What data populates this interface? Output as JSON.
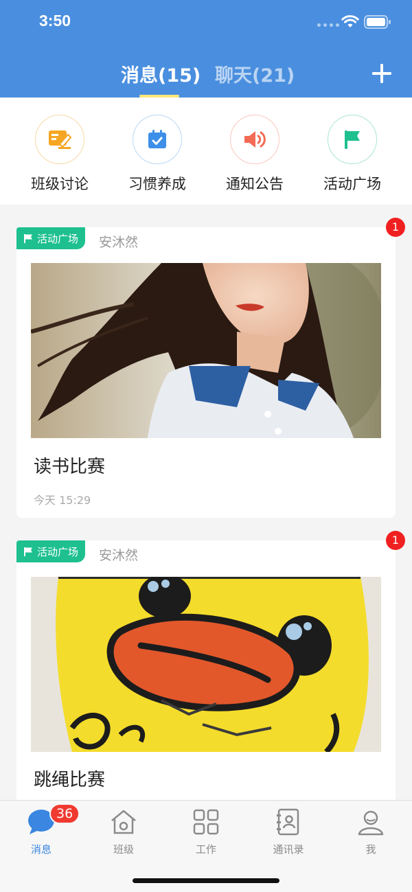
{
  "status_bar": {
    "time": "3:50"
  },
  "header": {
    "tab_messages": "消息(15)",
    "tab_chat": "聊天(21)"
  },
  "categories": [
    {
      "label": "班级讨论",
      "icon": "discussion-icon",
      "color": "#f5a623"
    },
    {
      "label": "习惯养成",
      "icon": "calendar-check-icon",
      "color": "#3d8fe8"
    },
    {
      "label": "通知公告",
      "icon": "speaker-icon",
      "color": "#f36a55"
    },
    {
      "label": "活动广场",
      "icon": "flag-icon",
      "color": "#1ec08f"
    }
  ],
  "feed": [
    {
      "tag": "活动广场",
      "author": "安沐然",
      "unread": "1",
      "title": "读书比赛",
      "time": "今天 15:29",
      "image": "girl-photo"
    },
    {
      "tag": "活动广场",
      "author": "安沐然",
      "unread": "1",
      "title": "跳绳比赛",
      "image": "yellow-duck-photo"
    }
  ],
  "tabbar": {
    "items": [
      {
        "label": "消息",
        "icon": "chat-bubble-icon",
        "badge": "36",
        "active": true
      },
      {
        "label": "班级",
        "icon": "home-icon"
      },
      {
        "label": "工作",
        "icon": "grid-icon"
      },
      {
        "label": "通讯录",
        "icon": "contacts-icon"
      },
      {
        "label": "我",
        "icon": "user-icon"
      }
    ]
  },
  "colors": {
    "header": "#4a8fdf",
    "tag": "#1ec08f",
    "badge": "#f02020",
    "active_tab": "#3a86e0"
  }
}
